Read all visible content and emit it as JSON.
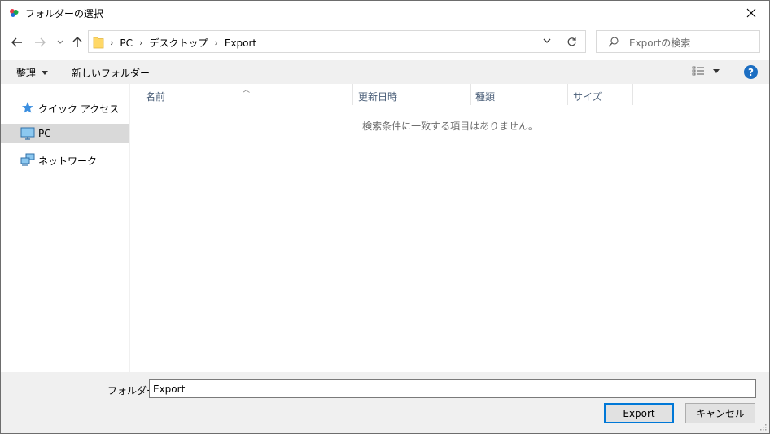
{
  "window": {
    "title": "フォルダーの選択"
  },
  "address": {
    "crumbs": [
      "PC",
      "デスクトップ",
      "Export"
    ]
  },
  "search": {
    "placeholder": "Exportの検索"
  },
  "toolbar": {
    "organize_label": "整理",
    "new_folder_label": "新しいフォルダー"
  },
  "sidebar": {
    "items": [
      {
        "label": "クイック アクセス",
        "icon": "quick-access-star-icon"
      },
      {
        "label": "PC",
        "icon": "pc-monitor-icon",
        "selected": true
      },
      {
        "label": "ネットワーク",
        "icon": "network-icon"
      }
    ]
  },
  "columns": [
    "名前",
    "更新日時",
    "種類",
    "サイズ"
  ],
  "list": {
    "empty_message": "検索条件に一致する項目はありません。"
  },
  "footer": {
    "folder_label": "フォルダー:",
    "folder_value": "Export",
    "confirm_label": "Export",
    "cancel_label": "キャンセル"
  },
  "colors": {
    "accent": "#0078d7",
    "help": "#1c6ec2",
    "selection": "#d9d9d9",
    "panel": "#f0f0f0"
  }
}
